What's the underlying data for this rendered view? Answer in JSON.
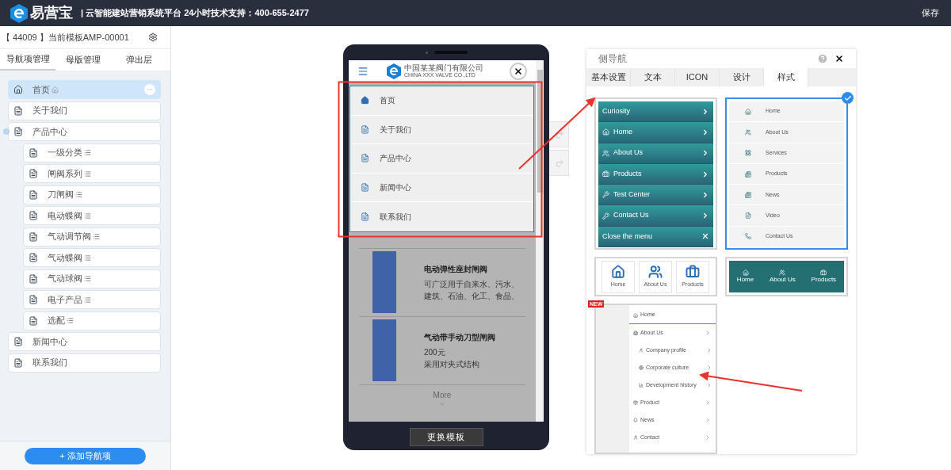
{
  "header": {
    "brand": "易营宝",
    "tagline": "| 云智能建站营销系统平台 24小时技术支持：400-655-2477",
    "save": "保存"
  },
  "sidebar": {
    "template": "【 44009 】当前模板AMP-00001",
    "tabs": [
      {
        "label": "导航项管理",
        "selected": true
      },
      {
        "label": "母版管理",
        "selected": false
      },
      {
        "label": "弹出层",
        "selected": false
      }
    ],
    "nav_items": [
      {
        "label": "首页",
        "kind": "home",
        "selected": true,
        "more": "..."
      },
      {
        "label": "关于我们",
        "kind": "page",
        "selected": false
      },
      {
        "label": "产品中心",
        "kind": "page",
        "selected": false,
        "expanded": true,
        "children": [
          {
            "label": "一级分类",
            "kind": "category",
            "selected": false
          },
          {
            "label": "闸阀系列",
            "kind": "category",
            "selected": false
          },
          {
            "label": "刀闸阀",
            "kind": "category",
            "selected": false
          },
          {
            "label": "电动蝶阀",
            "kind": "category",
            "selected": false
          },
          {
            "label": "气动调节阀",
            "kind": "category",
            "selected": false
          },
          {
            "label": "气动蝶阀",
            "kind": "category",
            "selected": false
          },
          {
            "label": "气动球阀",
            "kind": "category",
            "selected": false
          },
          {
            "label": "电子产品",
            "kind": "category",
            "selected": false
          },
          {
            "label": "选配",
            "kind": "category",
            "selected": false
          }
        ]
      },
      {
        "label": "新闻中心",
        "kind": "page",
        "selected": false
      },
      {
        "label": "联系我们",
        "kind": "page",
        "selected": false
      }
    ],
    "add_button": "+ 添加导航项"
  },
  "phone": {
    "company_name": "中国某某阀门有限公司",
    "company_en": "CHINA XXX VALVE CO.,LTD",
    "menu_items": [
      {
        "label": "首页",
        "kind": "home"
      },
      {
        "label": "关于我们",
        "kind": "page"
      },
      {
        "label": "产品中心",
        "kind": "page"
      },
      {
        "label": "新闻中心",
        "kind": "page"
      },
      {
        "label": "联系我们",
        "kind": "page"
      }
    ],
    "products": [
      {
        "title": "电动弹性座封闸阀",
        "lines": [
          "可广泛用于自来水、污水、",
          "建筑、石油、化工、食品、"
        ]
      },
      {
        "title": "气动带手动刀型闸阀",
        "lines": [
          "200元",
          "采用对夹式结构"
        ]
      }
    ],
    "more": "More",
    "change_template": "更换模板"
  },
  "panel": {
    "title": "侧导航",
    "tabs": [
      {
        "label": "基本设置",
        "selected": false
      },
      {
        "label": "文本",
        "selected": false
      },
      {
        "label": "ICON",
        "selected": false
      },
      {
        "label": "设计",
        "selected": false
      },
      {
        "label": "样式",
        "selected": true
      }
    ],
    "styles": [
      {
        "kind": "teal-list",
        "selected": false,
        "items": [
          {
            "label": "Curiosity",
            "kind": "header"
          },
          {
            "label": "Home",
            "kind": "link"
          },
          {
            "label": "About Us",
            "kind": "link"
          },
          {
            "label": "Products",
            "kind": "link"
          },
          {
            "label": "Test Center",
            "kind": "link"
          },
          {
            "label": "Contact Us",
            "kind": "link"
          },
          {
            "label": "Close the menu",
            "kind": "close"
          }
        ]
      },
      {
        "kind": "icon-list",
        "selected": true,
        "items": [
          {
            "label": "Home"
          },
          {
            "label": "About Us"
          },
          {
            "label": "Services"
          },
          {
            "label": "Products"
          },
          {
            "label": "News"
          },
          {
            "label": "Video"
          },
          {
            "label": "Contact Us"
          }
        ]
      },
      {
        "kind": "icon-tiles",
        "selected": false,
        "items": [
          {
            "label": "Home"
          },
          {
            "label": "About Us"
          },
          {
            "label": "Products"
          }
        ]
      },
      {
        "kind": "teal-bar",
        "selected": false,
        "items": [
          {
            "label": "Home"
          },
          {
            "label": "About Us"
          },
          {
            "label": "Products"
          }
        ]
      },
      {
        "kind": "tree",
        "selected": false,
        "badge": "NEW",
        "items": [
          {
            "label": "Home",
            "active": true
          },
          {
            "label": "About Us",
            "active": false,
            "children": [
              {
                "label": "Company profile"
              },
              {
                "label": "Corporate culture"
              },
              {
                "label": "Development history"
              }
            ]
          },
          {
            "label": "Product",
            "active": false
          },
          {
            "label": "News",
            "active": false
          },
          {
            "label": "Contact",
            "active": false
          }
        ]
      }
    ]
  }
}
